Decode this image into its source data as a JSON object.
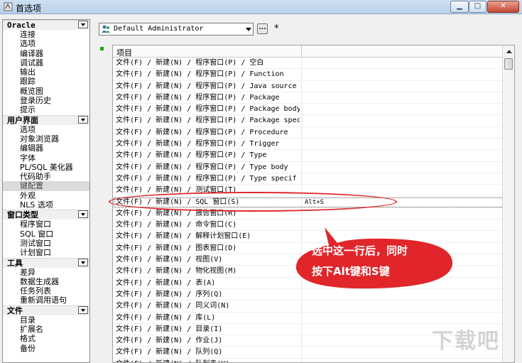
{
  "window": {
    "title": "首选项",
    "minimize": "▁",
    "maximize": "□",
    "close": "✕"
  },
  "sidebar": {
    "sections": [
      {
        "title": "Oracle",
        "items": [
          "连接",
          "选项",
          "编译器",
          "调试器",
          "输出",
          "跟踪",
          "概览图",
          "登录历史",
          "提示"
        ]
      },
      {
        "title": "用户界面",
        "items": [
          "选项",
          "对象浏览器",
          "编辑器",
          "字体",
          "PL/SQL 美化器",
          "代码助手",
          "键配置",
          "外观",
          "NLS 选项"
        ],
        "selected": "键配置"
      },
      {
        "title": "窗口类型",
        "items": [
          "程序窗口",
          "SQL 窗口",
          "测试窗口",
          "计划窗口"
        ]
      },
      {
        "title": "工具",
        "items": [
          "差异",
          "数据生成器",
          "任务列表",
          "重新调用语句"
        ]
      },
      {
        "title": "文件",
        "items": [
          "目录",
          "扩展名",
          "格式",
          "备份"
        ]
      }
    ]
  },
  "toolbar": {
    "profile": "Default Administrator",
    "more_label": "...",
    "modified_marker": "*"
  },
  "grid": {
    "header": "项目",
    "rows": [
      {
        "path": "文件(F) / 新建(N) / 程序窗口(P) / 空白",
        "key": ""
      },
      {
        "path": "文件(F) / 新建(N) / 程序窗口(P) / Function",
        "key": ""
      },
      {
        "path": "文件(F) / 新建(N) / 程序窗口(P) / Java source",
        "key": ""
      },
      {
        "path": "文件(F) / 新建(N) / 程序窗口(P) / Package",
        "key": ""
      },
      {
        "path": "文件(F) / 新建(N) / 程序窗口(P) / Package body",
        "key": ""
      },
      {
        "path": "文件(F) / 新建(N) / 程序窗口(P) / Package spec",
        "key": ""
      },
      {
        "path": "文件(F) / 新建(N) / 程序窗口(P) / Procedure",
        "key": ""
      },
      {
        "path": "文件(F) / 新建(N) / 程序窗口(P) / Trigger",
        "key": ""
      },
      {
        "path": "文件(F) / 新建(N) / 程序窗口(P) / Type",
        "key": ""
      },
      {
        "path": "文件(F) / 新建(N) / 程序窗口(P) / Type body",
        "key": ""
      },
      {
        "path": "文件(F) / 新建(N) / 程序窗口(P) / Type specif",
        "key": ""
      },
      {
        "path": "文件(F) / 新建(N) / 测试窗口(T)",
        "key": ""
      },
      {
        "path": "文件(F) / 新建(N) / SQL 窗口(S)",
        "key": "Alt+S",
        "selected": true
      },
      {
        "path": "文件(F) / 新建(N) / 报告窗口(R)",
        "key": ""
      },
      {
        "path": "文件(F) / 新建(N) / 命令窗口(C)",
        "key": ""
      },
      {
        "path": "文件(F) / 新建(N) / 解释计划窗口(E)",
        "key": ""
      },
      {
        "path": "文件(F) / 新建(N) / 图表窗口(D)",
        "key": ""
      },
      {
        "path": "文件(F) / 新建(N) / 视图(V)",
        "key": ""
      },
      {
        "path": "文件(F) / 新建(N) / 物化视图(M)",
        "key": ""
      },
      {
        "path": "文件(F) / 新建(N) / 表(A)",
        "key": ""
      },
      {
        "path": "文件(F) / 新建(N) / 序列(Q)",
        "key": ""
      },
      {
        "path": "文件(F) / 新建(N) / 同义词(N)",
        "key": ""
      },
      {
        "path": "文件(F) / 新建(N) / 库(L)",
        "key": ""
      },
      {
        "path": "文件(F) / 新建(N) / 目录(I)",
        "key": ""
      },
      {
        "path": "文件(F) / 新建(N) / 作业(J)",
        "key": ""
      },
      {
        "path": "文件(F) / 新建(N) / 队列(Q)",
        "key": ""
      },
      {
        "path": "文件(F) / 新建(N) / 队列表(U)",
        "key": ""
      }
    ]
  },
  "annotation": {
    "line1": "选中这一行后，同时",
    "line2": "按下Alt键和S键",
    "color": "#e0262a"
  },
  "watermark": "下载吧"
}
